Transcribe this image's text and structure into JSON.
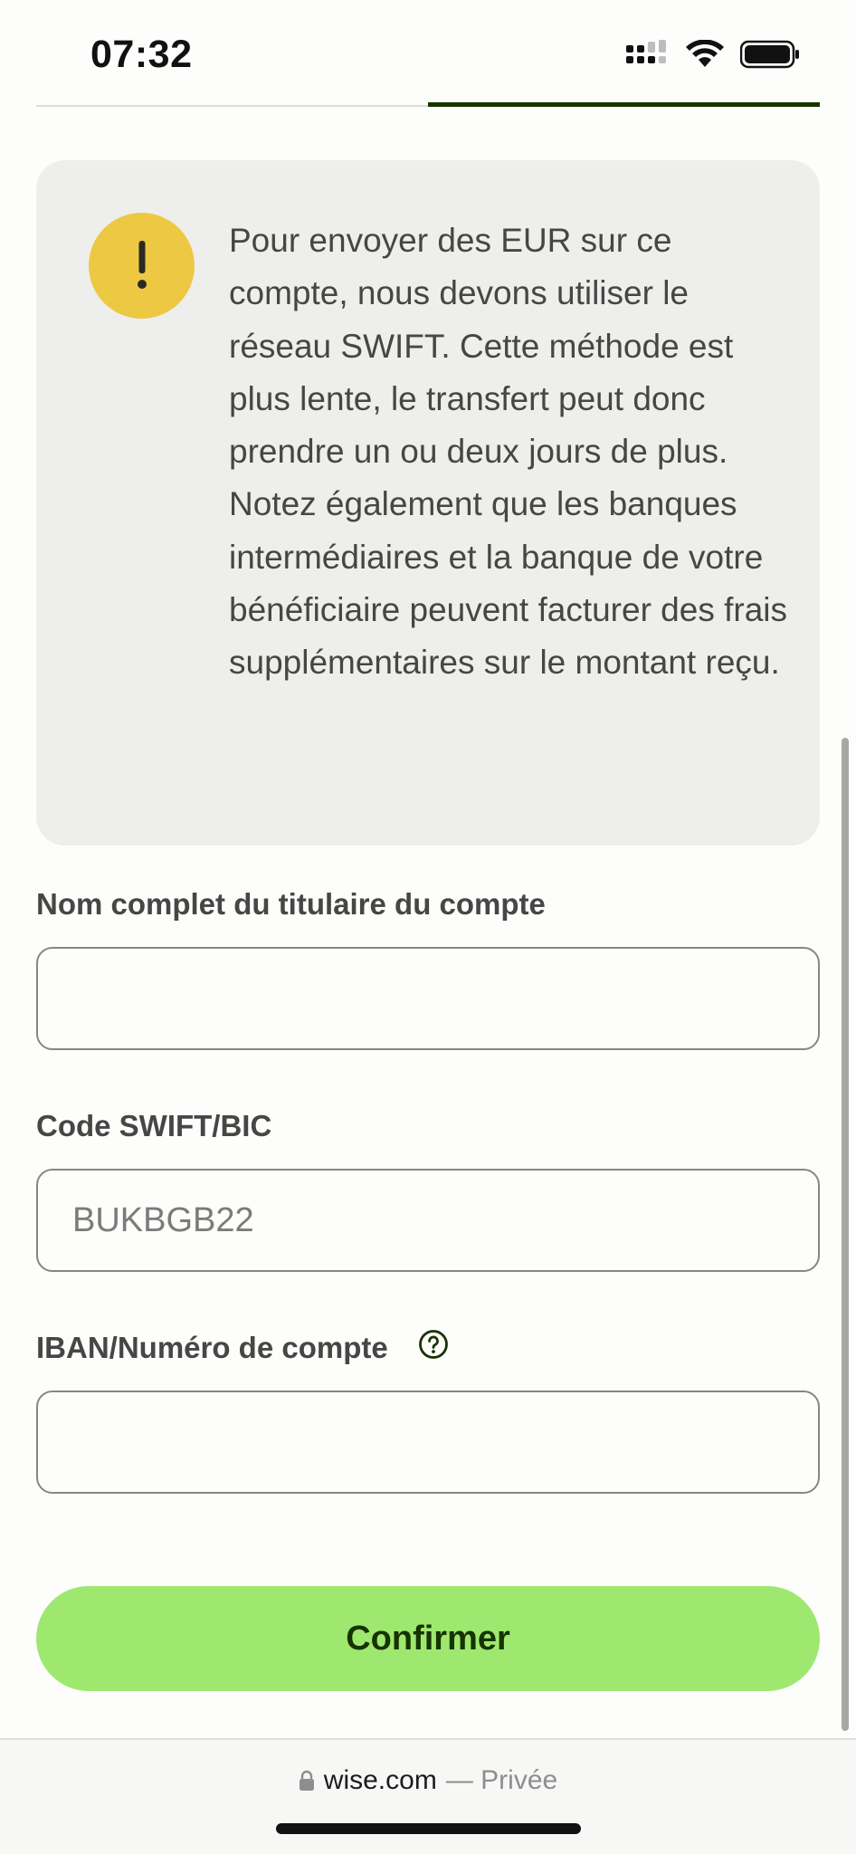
{
  "status_bar": {
    "time": "07:32",
    "icons": [
      "signal-icon",
      "wifi-icon",
      "battery-icon"
    ]
  },
  "alert": {
    "icon": "exclamation-icon",
    "icon_glyph": "!",
    "message": "Pour envoyer des EUR sur ce compte, nous devons utiliser le réseau SWIFT. Cette méthode est plus lente, le transfert peut donc prendre un ou deux jours de plus. Notez également que les banques intermédiaires et la banque de votre bénéficiaire peuvent facturer des frais supplémentaires sur le montant reçu."
  },
  "form": {
    "account_holder": {
      "label": "Nom complet du titulaire du compte",
      "value": "",
      "placeholder": ""
    },
    "swift": {
      "label": "Code SWIFT/BIC",
      "value": "",
      "placeholder": "BUKBGB22"
    },
    "iban": {
      "label": "IBAN/Numéro de compte",
      "value": "",
      "placeholder": "",
      "help_icon": "question-circle-icon"
    },
    "confirm_label": "Confirmer"
  },
  "browser": {
    "lock_icon": "lock-icon",
    "domain": "wise.com",
    "privacy": "— Privée"
  },
  "colors": {
    "accent_green": "#9fe870",
    "dark_green": "#163300",
    "warning_yellow": "#edc843",
    "card_background": "#eeefec"
  }
}
